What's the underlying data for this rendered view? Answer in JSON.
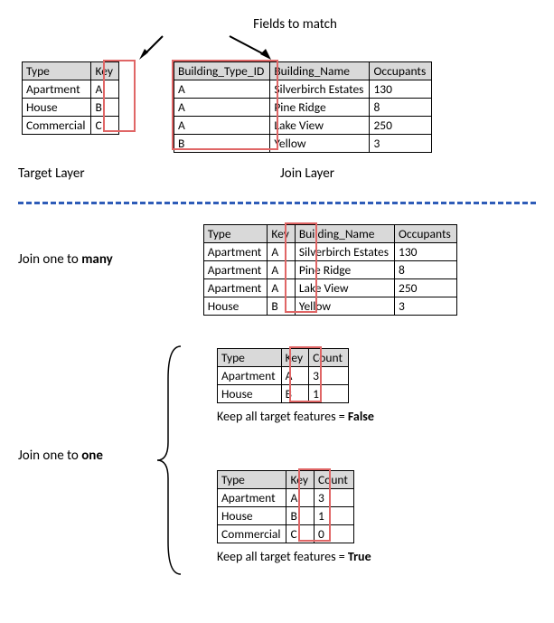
{
  "title_top": "Fields to match",
  "target_layer_label": "Target Layer",
  "join_layer_label": "Join Layer",
  "join_one_to_many_label_a": "Join one to ",
  "join_one_to_many_label_b": "many",
  "join_one_to_one_label_a": "Join one to ",
  "join_one_to_one_label_b": "one",
  "keep_all_false_a": "Keep all target features = ",
  "keep_all_false_b": "False",
  "keep_all_true_a": "Keep all target features = ",
  "keep_all_true_b": "True",
  "target_table": {
    "headers": [
      "Type",
      "Key"
    ],
    "rows": [
      [
        "Apartment",
        "A"
      ],
      [
        "House",
        "B"
      ],
      [
        "Commercial",
        "C"
      ]
    ]
  },
  "join_table": {
    "headers": [
      "Building_Type_ID",
      "Building_Name",
      "Occupants"
    ],
    "rows": [
      [
        "A",
        "Silverbirch Estates",
        "130"
      ],
      [
        "A",
        "Pine Ridge",
        "8"
      ],
      [
        "A",
        "Lake View",
        "250"
      ],
      [
        "B",
        "Yellow",
        "3"
      ]
    ]
  },
  "one_to_many_table": {
    "headers": [
      "Type",
      "Key",
      "Building_Name",
      "Occupants"
    ],
    "rows": [
      [
        "Apartment",
        "A",
        "Silverbirch Estates",
        "130"
      ],
      [
        "Apartment",
        "A",
        "Pine Ridge",
        "8"
      ],
      [
        "Apartment",
        "A",
        "Lake View",
        "250"
      ],
      [
        "House",
        "B",
        "Yellow",
        "3"
      ]
    ]
  },
  "one_to_one_false_table": {
    "headers": [
      "Type",
      "Key",
      "Count"
    ],
    "rows": [
      [
        "Apartment",
        "A",
        "3"
      ],
      [
        "House",
        "B",
        "1"
      ]
    ]
  },
  "one_to_one_true_table": {
    "headers": [
      "Type",
      "Key",
      "Count"
    ],
    "rows": [
      [
        "Apartment",
        "A",
        "3"
      ],
      [
        "House",
        "B",
        "1"
      ],
      [
        "Commercial",
        "C",
        "0"
      ]
    ]
  }
}
